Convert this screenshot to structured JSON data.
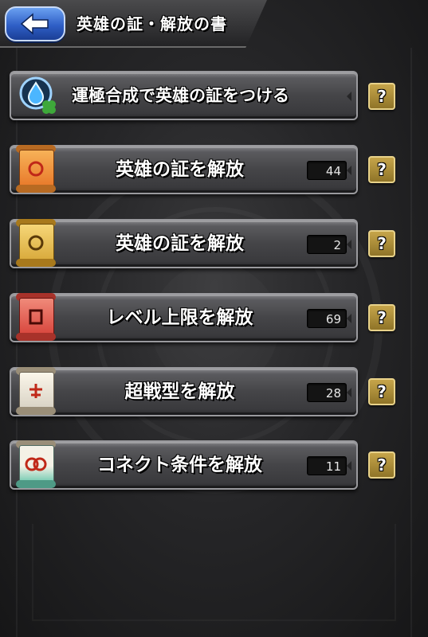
{
  "header": {
    "title": "英雄の証・解放の書",
    "back_icon": "back-arrow-icon",
    "accent": "#3c6fd8"
  },
  "rows": [
    {
      "label": "運極合成で英雄の証をつける",
      "count": "",
      "icon": "droplet-clover-icon"
    },
    {
      "label": "英雄の証を解放",
      "count": "44",
      "icon": "scroll-orange-icon",
      "color": "#e8782a"
    },
    {
      "label": "英雄の証を解放",
      "count": "2",
      "icon": "scroll-gold-icon",
      "color": "#d8a93a"
    },
    {
      "label": "レベル上限を解放",
      "count": "69",
      "icon": "scroll-red-icon",
      "color": "#d8453c"
    },
    {
      "label": "超戦型を解放",
      "count": "28",
      "icon": "scroll-white-icon",
      "color": "#d8d2c4"
    },
    {
      "label": "コネクト条件を解放",
      "count": "11",
      "icon": "scroll-teal-icon",
      "color": "#6fc9b0"
    }
  ],
  "help_label": "?",
  "colors": {
    "help_button": "#b8963e",
    "plate": "#4a4a4e"
  }
}
